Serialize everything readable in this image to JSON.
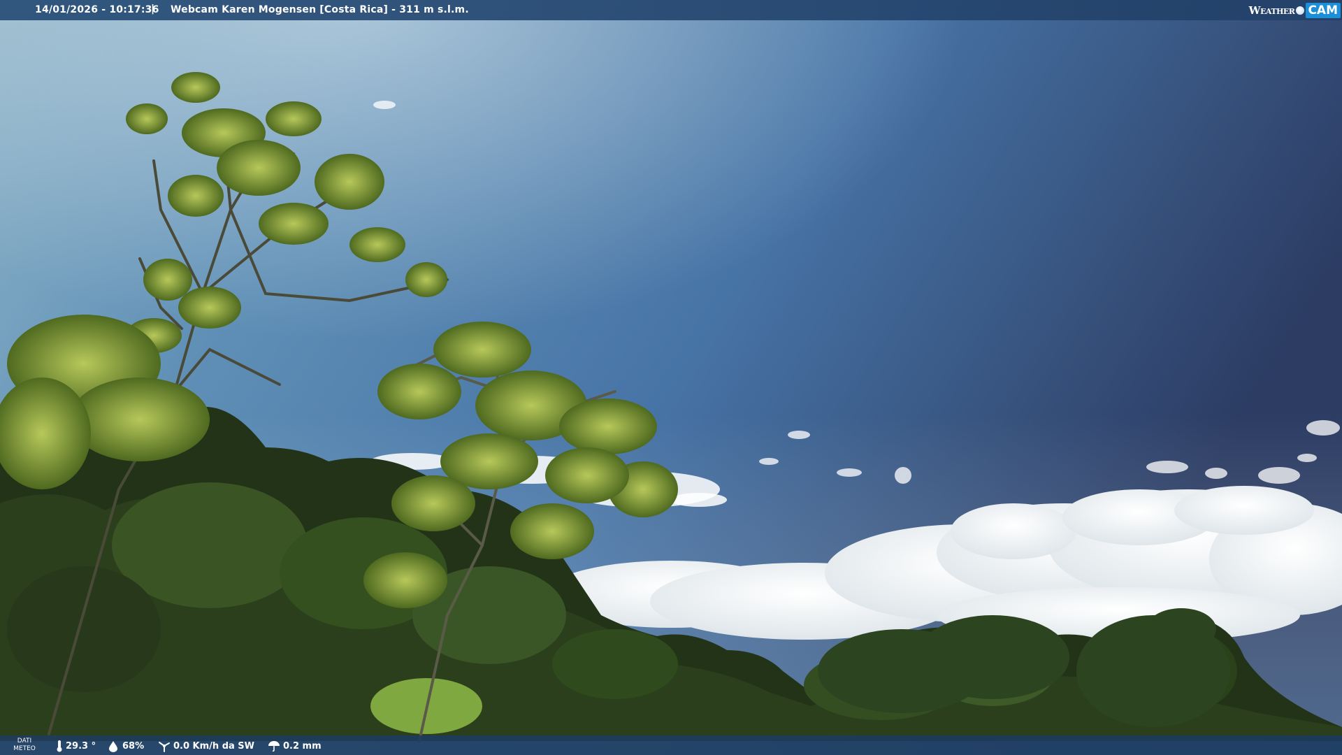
{
  "header": {
    "timestamp": "14/01/2026 - 10:17:36",
    "separator": "|",
    "title": "Webcam Karen Mogensen [Costa Rica] - 311 m s.l.m.",
    "logo": {
      "part1": "Weather",
      "part2": "CAM"
    }
  },
  "footer": {
    "label_line1": "DATI",
    "label_line2": "METEO",
    "temperature": "29.3 °",
    "humidity": "68%",
    "wind": "0.0 Km/h da SW",
    "rain": "0.2 mm"
  },
  "icons": {
    "temperature": "thermometer-icon",
    "humidity": "humidity-drop-icon",
    "wind": "wind-icon",
    "rain": "rain-umbrella-icon"
  },
  "colors": {
    "sky_top_left": "#8fb4c9",
    "sky_mid": "#4a79a8",
    "sky_right": "#2f3f66",
    "foliage_dark": "#1c2a12",
    "foliage_light": "#8fae3a",
    "cloud": "#f2f5f7",
    "bar": "#284e78",
    "logo_accent": "#1c8fd6"
  }
}
